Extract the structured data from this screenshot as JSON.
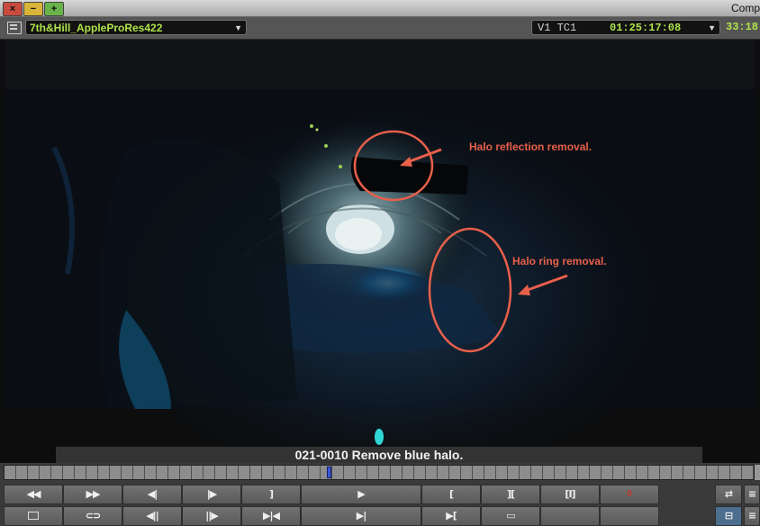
{
  "window": {
    "title": "Comp"
  },
  "toolbar": {
    "clip_name": "7th&Hill_AppleProRes422",
    "track_label": "V1 TC1",
    "timecode": "01:25:17:08",
    "timecode2": "33:18"
  },
  "annotations": [
    {
      "text": "Halo reflection removal."
    },
    {
      "text": "Halo ring removal."
    }
  ],
  "caption": "021-0010 Remove blue halo.",
  "timeline": {
    "playhead_fraction": 0.43
  },
  "colors": {
    "annotation": "#e8604a",
    "timecode": "#aee34a",
    "marker": "#2fd6d6"
  },
  "controls": {
    "row1": [
      "rewind-icon",
      "fast-forward-icon",
      "step-back-icon",
      "step-forward-icon",
      "mark-out-icon",
      "play-icon",
      "mark-in-icon",
      "clear-marks-icon",
      "match-frame-icon",
      "0",
      "extra-icon-1",
      "extra-icon-2"
    ],
    "row2": [
      "list-icon",
      "link-icon",
      "step-back-10-icon",
      "step-forward-10-icon",
      "trim-icon",
      "go-to-out-icon",
      "go-to-in-icon",
      "gang-icon",
      "blank-1",
      "blank-2",
      "blank-3",
      "toggle-view-icon",
      "menu-icon"
    ]
  }
}
